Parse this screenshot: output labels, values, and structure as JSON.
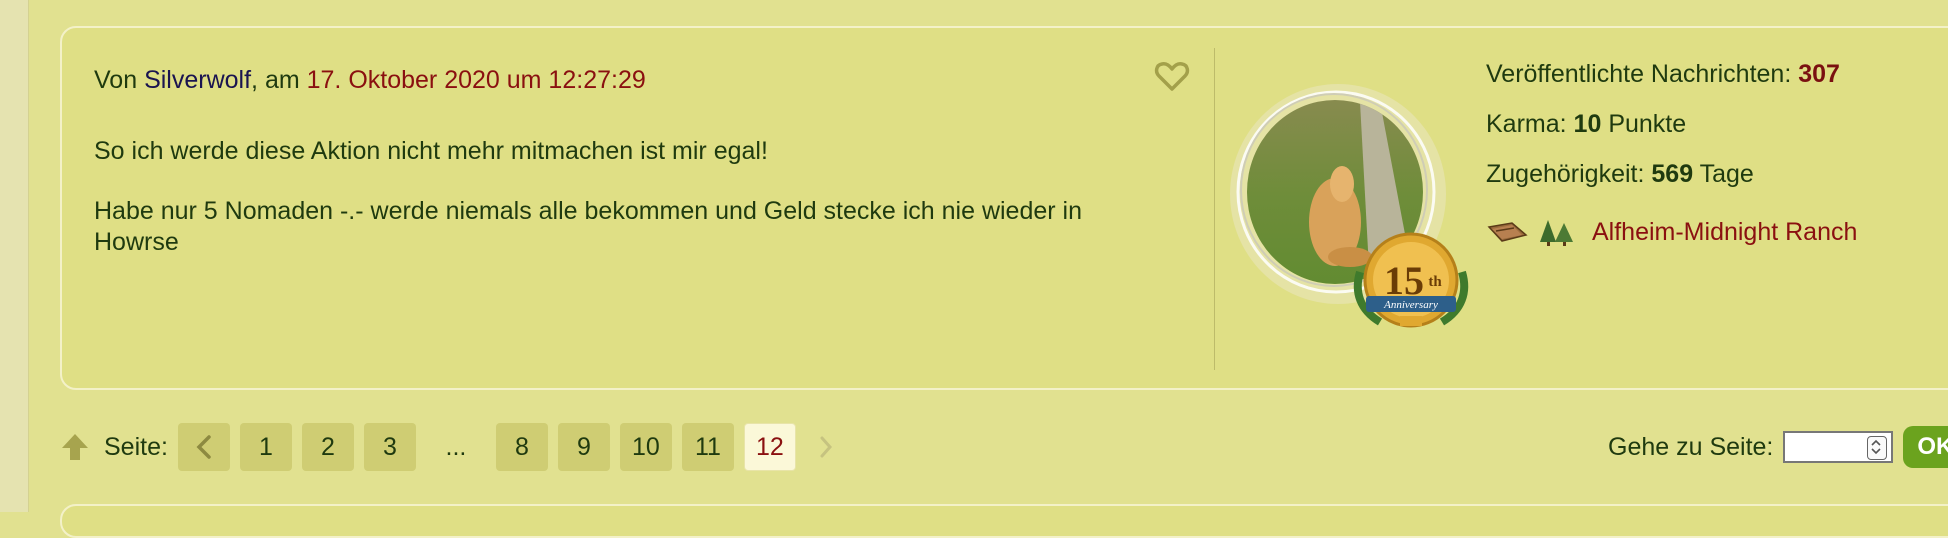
{
  "post": {
    "prefix": "Von",
    "author": "Silverwolf",
    "date_sep": ", am",
    "date": "17. Oktober 2020 um 12:27:29",
    "message_line1": "So ich werde diese Aktion nicht mehr mitmachen ist mir egal!",
    "message_line2": "Habe nur 5 Nomaden -.- werde niemals alle bekommen und Geld stecke ich nie wieder in Howrse"
  },
  "profile": {
    "messages_label": "Veröffentlichte Nachrichten:",
    "messages_value": "307",
    "karma_label": "Karma:",
    "karma_value": "10",
    "karma_unit": "Punkte",
    "membership_label": "Zugehörigkeit:",
    "membership_value": "569",
    "membership_unit": "Tage",
    "ranch_name": "Alfheim-Midnight Ranch",
    "badge_number": "15",
    "badge_suffix": "th",
    "badge_text": "Anniversary"
  },
  "pagination": {
    "label": "Seite:",
    "pages": [
      "1",
      "2",
      "3"
    ],
    "ellipsis": "...",
    "pages_after": [
      "8",
      "9",
      "10",
      "11"
    ],
    "current": "12",
    "goto_label": "Gehe zu Seite:",
    "goto_value": "",
    "ok_label": "OK"
  },
  "icons": {
    "heart": "heart-icon",
    "up": "arrow-up-icon",
    "prev": "chevron-left-icon",
    "next": "chevron-right-icon"
  },
  "colors": {
    "background": "#e1e190",
    "post_bg": "#dfdf85",
    "link_red": "#8a1010",
    "author_navy": "#1a1450",
    "button_green": "#6ba31e"
  }
}
